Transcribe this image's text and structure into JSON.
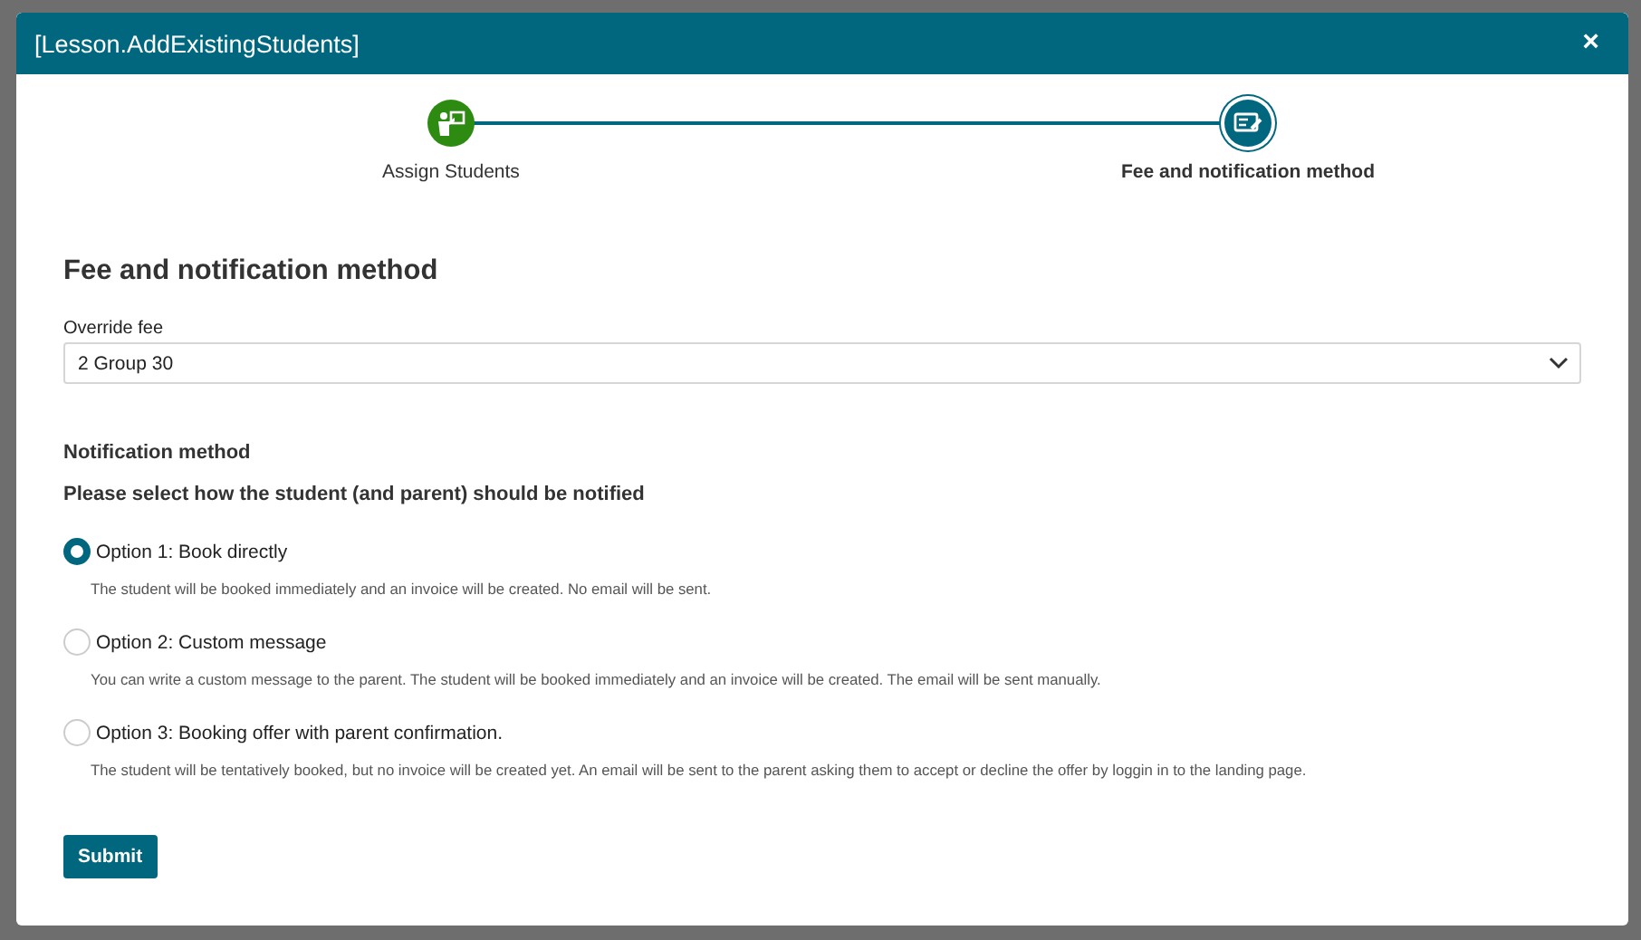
{
  "window": {
    "title": "[Lesson.AddExistingStudents]",
    "close": "×"
  },
  "steps": [
    {
      "label": "Assign Students",
      "kind": "done",
      "selected": false
    },
    {
      "label": "Fee and notification method",
      "kind": "current",
      "selected": true
    }
  ],
  "heading": "Fee and notification method",
  "fee": {
    "label": "Override fee",
    "value": "2 Group 30"
  },
  "notification": {
    "title": "Notification method",
    "prompt": "Please select how the student (and parent) should be notified",
    "options": [
      {
        "label": "Option 1: Book directly",
        "description": "The student will be booked immediately and an invoice will be created. No email will be sent.",
        "selected": true
      },
      {
        "label": "Option 2: Custom message",
        "description": "You can write a custom message to the parent. The student will be booked immediately and an invoice will be created. The email will be sent manually.",
        "selected": false
      },
      {
        "label": "Option 3: Booking offer with parent confirmation.",
        "description": "The student will be tentatively booked, but no invoice will be created yet. An email will be sent to the parent asking them to accept or decline the offer by loggin in to the landing page.",
        "selected": false
      }
    ]
  },
  "submit": "Submit"
}
